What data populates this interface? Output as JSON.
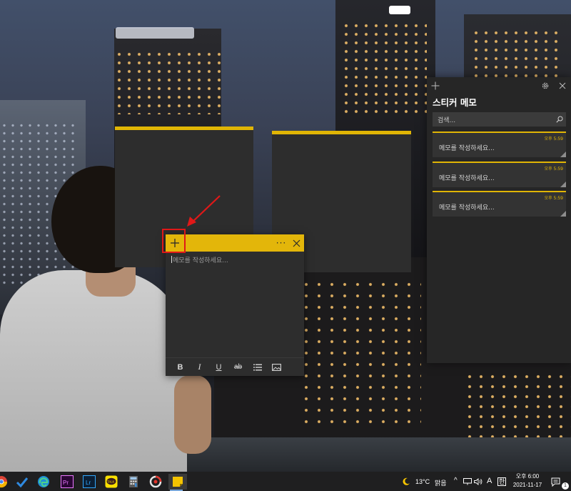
{
  "colors": {
    "note_accent": "#e0b505",
    "note_body": "#2d2d2d",
    "panel_bg": "#262626",
    "annotation_red": "#e01818",
    "taskbar_bg": "#1f1f20"
  },
  "wallpaper": {
    "subject": "city night view"
  },
  "active_note": {
    "add_icon": "plus-icon",
    "menu_label": "···",
    "close_icon": "close-icon",
    "placeholder": "메모를 작성하세요...",
    "toolbar": {
      "bold": "B",
      "italic": "I",
      "underline": "U",
      "strikethrough": "ab",
      "list_icon": "bullet-list-icon",
      "image_icon": "image-icon"
    }
  },
  "panel": {
    "title": "스티커 메모",
    "search_placeholder": "검색...",
    "add_icon": "plus-icon",
    "settings_icon": "gear-icon",
    "close_icon": "close-icon",
    "notes": [
      {
        "time": "오후 5:59",
        "text": "메모를 작성하세요..."
      },
      {
        "time": "오후 5:59",
        "text": "메모를 작성하세요..."
      },
      {
        "time": "오후 5:59",
        "text": "메모를 작성하세요..."
      }
    ]
  },
  "taskbar": {
    "apps": [
      {
        "name": "chrome-icon"
      },
      {
        "name": "todo-icon"
      },
      {
        "name": "edge-icon"
      },
      {
        "name": "premiere-pro-icon",
        "label": "Pr"
      },
      {
        "name": "lightroom-icon",
        "label": "Lr"
      },
      {
        "name": "kakaotalk-icon",
        "label": "TALK"
      },
      {
        "name": "calculator-icon"
      },
      {
        "name": "screen-recorder-icon"
      },
      {
        "name": "sticky-notes-icon"
      }
    ],
    "weather": {
      "temp": "13°C",
      "condition": "맑음"
    },
    "tray": {
      "chevron": "^",
      "language_label": "A",
      "ime_label": "한"
    },
    "clock": {
      "time": "오후 6:00",
      "date": "2021-11-17"
    },
    "notification_count": "1"
  }
}
